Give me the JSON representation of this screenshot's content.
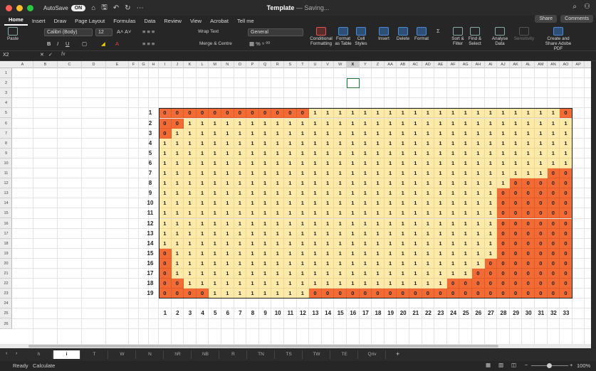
{
  "window": {
    "autosave_label": "AutoSave",
    "autosave_state": "ON",
    "title": "Template",
    "title_status": " — Saving..."
  },
  "menu": [
    "Home",
    "Insert",
    "Draw",
    "Page Layout",
    "Formulas",
    "Data",
    "Review",
    "View",
    "Acrobat",
    "Tell me"
  ],
  "share_label": "Share",
  "comments_label": "Comments",
  "ribbon": {
    "paste": "Paste",
    "font": "Calibri (Body)",
    "size": "12",
    "wrap": "Wrap Text",
    "merge": "Merge & Centre",
    "numfmt": "General",
    "cond": "Conditional Formatting",
    "fmt_table": "Format as Table",
    "cell_styles": "Cell Styles",
    "insert": "Insert",
    "delete": "Delete",
    "format": "Format",
    "sort": "Sort & Filter",
    "find": "Find & Select",
    "analyse": "Analyse Data",
    "sensitivity": "Sensitivity",
    "pdf": "Create and Share Adobe PDF"
  },
  "formula": {
    "namebox": "X2",
    "fx": "fx"
  },
  "columns": [
    "A",
    "B",
    "C",
    "D",
    "E",
    "F",
    "G",
    "H",
    "I",
    "J",
    "K",
    "L",
    "M",
    "N",
    "O",
    "P",
    "Q",
    "R",
    "S",
    "T",
    "U",
    "V",
    "W",
    "X",
    "Y",
    "Z",
    "AA",
    "AB",
    "AC",
    "AD",
    "AE",
    "AF",
    "AG",
    "AH",
    "AI",
    "AJ",
    "AK",
    "AL",
    "AM",
    "AN",
    "AO",
    "AP"
  ],
  "selected_column": "X",
  "rows": [
    "1",
    "2",
    "3",
    "4",
    "5",
    "6",
    "7",
    "8",
    "9",
    "10",
    "11",
    "12",
    "13",
    "14",
    "15",
    "16",
    "17",
    "18",
    "19",
    "20",
    "21",
    "22",
    "23",
    "24",
    "25",
    "26"
  ],
  "grid_colors": {
    "zero": "#f26b35",
    "one": "#fde9a8",
    "border": "#222222"
  },
  "row_labels": [
    "1",
    "2",
    "3",
    "4",
    "5",
    "6",
    "7",
    "8",
    "9",
    "10",
    "11",
    "12",
    "13",
    "14",
    "15",
    "16",
    "17",
    "18",
    "19"
  ],
  "col_labels": [
    "1",
    "2",
    "3",
    "4",
    "5",
    "6",
    "7",
    "8",
    "9",
    "10",
    "11",
    "12",
    "13",
    "14",
    "15",
    "16",
    "17",
    "18",
    "19",
    "20",
    "21",
    "22",
    "23",
    "24",
    "25",
    "26",
    "27",
    "28",
    "29",
    "30",
    "31",
    "32",
    "33"
  ],
  "matrix": [
    "000000000000111111111111111111110",
    "001111111111111111111111111111111",
    "011111111111111111111111111111111",
    "111111111111111111111111111111111",
    "111111111111111111111111111111111",
    "111111111111111111111111111111111",
    "111111111111111111111111111111100",
    "111111111111111111111111111100000",
    "111111111111111111111111111000000",
    "111111111111111111111111111000000",
    "111111111111111111111111111000000",
    "111111111111111111111111111000000",
    "111111111111111111111111111000000",
    "111111111111111111111111111000000",
    "011111111111111111111111111000000",
    "011111111111111111111111110000000",
    "011111111111111111111111100000000",
    "001111111111111111111110000000000",
    "000011111111000000000000000000000"
  ],
  "sheets": [
    "h",
    "i",
    "T",
    "W",
    "N",
    "hR",
    "NB",
    "R",
    "TN",
    "TS",
    "TW",
    "TE",
    "Qriv"
  ],
  "active_sheet": "i",
  "status": {
    "ready": "Ready",
    "calculate": "Calculate",
    "zoom": "100%"
  }
}
